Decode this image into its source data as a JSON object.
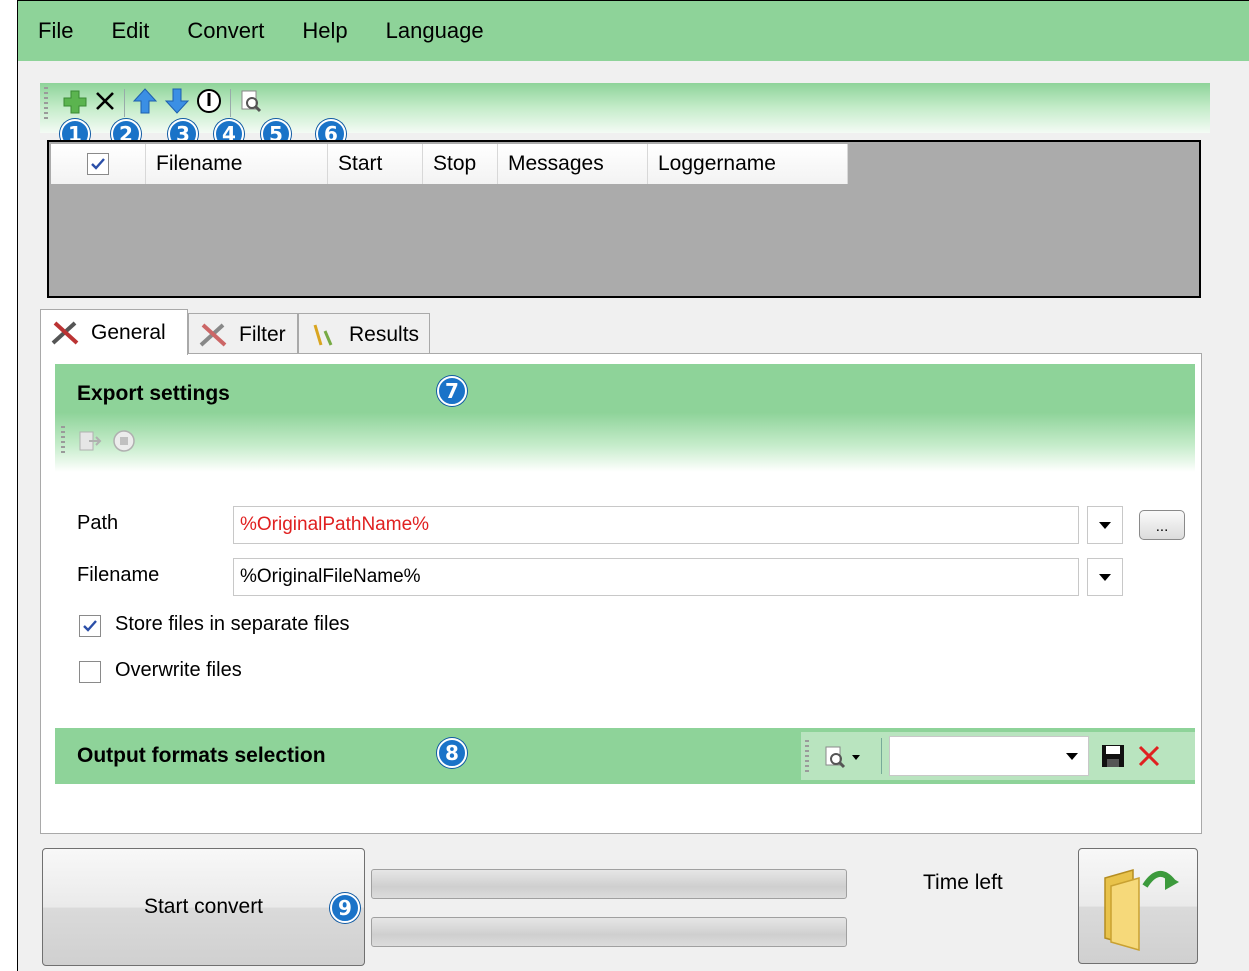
{
  "menu": [
    "File",
    "Edit",
    "Convert",
    "Help",
    "Language"
  ],
  "toolbar": {
    "icons": [
      "add-icon",
      "delete-icon",
      "move-up-icon",
      "move-down-icon",
      "info-icon",
      "preview-icon"
    ]
  },
  "badges": [
    "1",
    "2",
    "3",
    "4",
    "5",
    "6",
    "7",
    "8",
    "9"
  ],
  "grid": {
    "columns": [
      "Filename",
      "Start",
      "Stop",
      "Messages",
      "Loggername"
    ],
    "header_checked": true
  },
  "tabs": [
    "General",
    "Filter",
    "Results"
  ],
  "export": {
    "title": "Export settings",
    "path_label": "Path",
    "path_value": "%OriginalPathName%",
    "path_value_color": "#e02020",
    "filename_label": "Filename",
    "filename_value": "%OriginalFileName%",
    "browse_label": "...",
    "store_separate_label": "Store files in separate files",
    "store_separate_checked": true,
    "overwrite_label": "Overwrite files",
    "overwrite_checked": false
  },
  "output": {
    "title": "Output formats selection",
    "selected": ""
  },
  "bottom": {
    "start_label": "Start convert",
    "time_left_label": "Time left",
    "progress1": 0,
    "progress2": 0
  },
  "colors": {
    "accent_green": "#8ed399",
    "badge_blue": "#1a73c8"
  }
}
